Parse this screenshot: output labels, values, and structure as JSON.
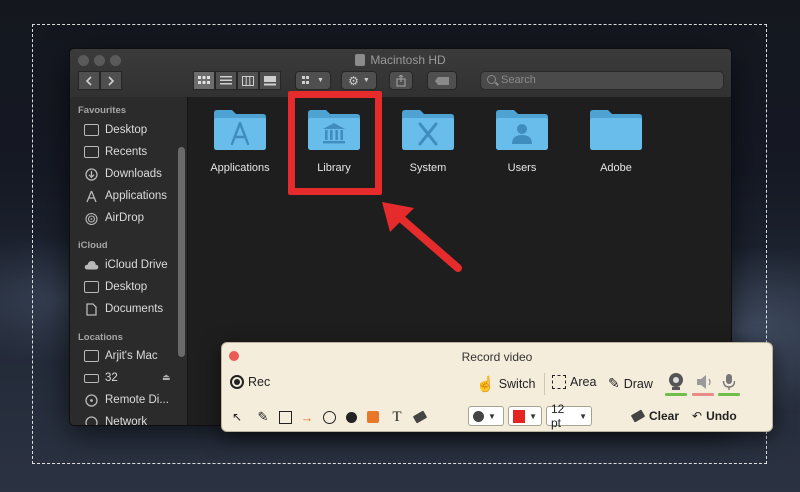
{
  "window": {
    "title": "Macintosh HD",
    "search_placeholder": "Search"
  },
  "sidebar": {
    "sections": [
      {
        "heading": "Favourites",
        "items": [
          {
            "label": "Desktop",
            "icon": "desktop-icon"
          },
          {
            "label": "Recents",
            "icon": "recents-icon"
          },
          {
            "label": "Downloads",
            "icon": "downloads-icon"
          },
          {
            "label": "Applications",
            "icon": "applications-icon"
          },
          {
            "label": "AirDrop",
            "icon": "airdrop-icon"
          }
        ]
      },
      {
        "heading": "iCloud",
        "items": [
          {
            "label": "iCloud Drive",
            "icon": "cloud-icon"
          },
          {
            "label": "Desktop",
            "icon": "desktop-icon"
          },
          {
            "label": "Documents",
            "icon": "documents-icon"
          }
        ]
      },
      {
        "heading": "Locations",
        "items": [
          {
            "label": "Arjit's Mac",
            "icon": "computer-icon"
          },
          {
            "label": "32",
            "icon": "drive-icon"
          },
          {
            "label": "Remote Di...",
            "icon": "remote-disc-icon"
          },
          {
            "label": "Network",
            "icon": "network-icon"
          }
        ]
      }
    ]
  },
  "folders": [
    {
      "label": "Applications",
      "icon": "applications-folder-icon"
    },
    {
      "label": "Library",
      "icon": "library-folder-icon"
    },
    {
      "label": "System",
      "icon": "system-folder-icon"
    },
    {
      "label": "Users",
      "icon": "users-folder-icon"
    },
    {
      "label": "Adobe",
      "icon": "folder-icon"
    }
  ],
  "record_panel": {
    "title": "Record video",
    "rec_label": "Rec",
    "switch_label": "Switch",
    "area_label": "Area",
    "draw_label": "Draw",
    "size_value": "12 pt",
    "clear_label": "Clear",
    "undo_label": "Undo",
    "pen_color": "#e52424",
    "text_tool_glyph": "T"
  },
  "colors": {
    "folder_blue": "#5fb7e6",
    "highlight_red": "#e52b2b",
    "webcam_status": "#6fbe4a",
    "audio_status": "#e88a8a"
  }
}
